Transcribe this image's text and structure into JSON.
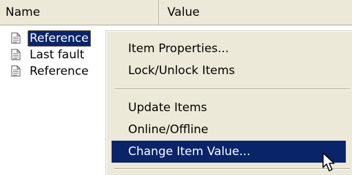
{
  "columns": {
    "name": "Name",
    "value": "Value"
  },
  "items": [
    {
      "label": "Reference",
      "icon": "document-icon",
      "selected": true
    },
    {
      "label": "Last fault",
      "icon": "document-icon",
      "selected": false
    },
    {
      "label": "Reference",
      "icon": "document-icon",
      "selected": false
    }
  ],
  "context_menu": {
    "items": [
      {
        "label": "Item Properties..."
      },
      {
        "label": "Lock/Unlock Items"
      },
      {
        "label": "Update Items"
      },
      {
        "label": "Online/Offline"
      },
      {
        "label": "Change Item Value...",
        "highlighted": true
      }
    ]
  },
  "colors": {
    "selection": "#0a246a",
    "menu_background": "#ece9d8",
    "header_background": "#ece9d8"
  }
}
